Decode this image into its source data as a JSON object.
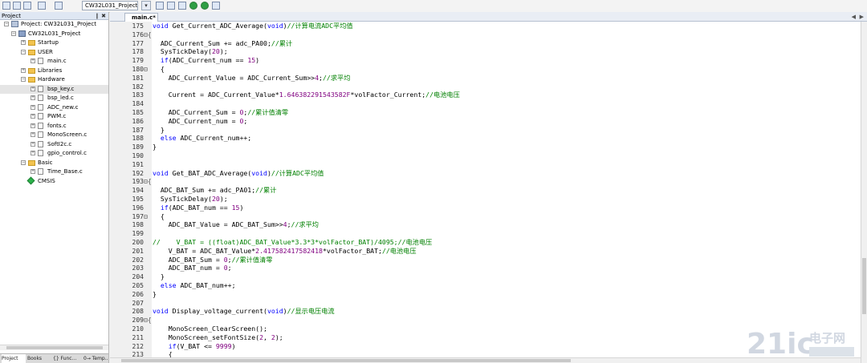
{
  "toolbar": {
    "target_name": "CW32L031_Project"
  },
  "project_panel": {
    "title": "Project",
    "controls": "❙ ✖",
    "tree": [
      {
        "label": "Project: CW32L031_Project",
        "level": 0,
        "icon": "project-icon",
        "expander": "−"
      },
      {
        "label": "CW32L031_Project",
        "level": 1,
        "icon": "target-icon",
        "expander": "−"
      },
      {
        "label": "Startup",
        "level": 2,
        "icon": "folder-icon",
        "expander": "+"
      },
      {
        "label": "USER",
        "level": 2,
        "icon": "folder-icon",
        "expander": "−"
      },
      {
        "label": "main.c",
        "level": 3,
        "icon": "file-icon",
        "expander": "+"
      },
      {
        "label": "Libraries",
        "level": 2,
        "icon": "folder-icon",
        "expander": "+"
      },
      {
        "label": "Hardware",
        "level": 2,
        "icon": "folder-icon",
        "expander": "−"
      },
      {
        "label": "bsp_key.c",
        "level": 3,
        "icon": "file-icon",
        "expander": "+",
        "selected": true
      },
      {
        "label": "bsp_led.c",
        "level": 3,
        "icon": "file-icon",
        "expander": "+"
      },
      {
        "label": "ADC_new.c",
        "level": 3,
        "icon": "file-icon",
        "expander": "+"
      },
      {
        "label": "PWM.c",
        "level": 3,
        "icon": "file-icon",
        "expander": "+"
      },
      {
        "label": "fonts.c",
        "level": 3,
        "icon": "file-icon",
        "expander": "+"
      },
      {
        "label": "MonoScreen.c",
        "level": 3,
        "icon": "file-icon",
        "expander": "+"
      },
      {
        "label": "SoftI2c.c",
        "level": 3,
        "icon": "file-icon",
        "expander": "+"
      },
      {
        "label": "gpio_control.c",
        "level": 3,
        "icon": "file-icon",
        "expander": "+"
      },
      {
        "label": "Basic",
        "level": 2,
        "icon": "folder-icon",
        "expander": "−"
      },
      {
        "label": "Time_Base.c",
        "level": 3,
        "icon": "file-icon",
        "expander": "+"
      },
      {
        "label": "CMSIS",
        "level": 2,
        "icon": "gem-icon",
        "expander": ""
      }
    ],
    "bottom_tabs": [
      {
        "label": "Project",
        "active": true
      },
      {
        "label": "Books"
      },
      {
        "label": "{} Func..."
      },
      {
        "label": "0→ Temp..."
      }
    ]
  },
  "editor": {
    "tab_label": "main.c*",
    "lines": [
      {
        "n": "175",
        "fold": "",
        "segs": [
          [
            "kw",
            "void"
          ],
          [
            "t",
            " Get_Current_ADC_Average("
          ],
          [
            "kw",
            "void"
          ],
          [
            "t",
            ")"
          ],
          [
            "cm",
            "//计算电流ADC平均值"
          ]
        ]
      },
      {
        "n": "176",
        "fold": "⊟{",
        "segs": []
      },
      {
        "n": "177",
        "fold": "",
        "segs": [
          [
            "t",
            "  ADC_Current_Sum += adc_PA00;"
          ],
          [
            "cm",
            "//累计"
          ]
        ]
      },
      {
        "n": "178",
        "fold": "",
        "segs": [
          [
            "t",
            "  SysTickDelay("
          ],
          [
            "num",
            "20"
          ],
          [
            "t",
            ");"
          ]
        ]
      },
      {
        "n": "179",
        "fold": "",
        "segs": [
          [
            "t",
            "  "
          ],
          [
            "kw",
            "if"
          ],
          [
            "t",
            "(ADC_Current_num == "
          ],
          [
            "num",
            "15"
          ],
          [
            "t",
            ")"
          ]
        ]
      },
      {
        "n": "180",
        "fold": "⊟",
        "segs": [
          [
            "t",
            "  {"
          ]
        ]
      },
      {
        "n": "181",
        "fold": "",
        "segs": [
          [
            "t",
            "    ADC_Current_Value = ADC_Current_Sum>>"
          ],
          [
            "num",
            "4"
          ],
          [
            "t",
            ";"
          ],
          [
            "cm",
            "//求平均"
          ]
        ]
      },
      {
        "n": "182",
        "fold": "",
        "segs": []
      },
      {
        "n": "183",
        "fold": "",
        "segs": [
          [
            "t",
            "    Current = ADC_Current_Value*"
          ],
          [
            "num",
            "1.646382291543582F"
          ],
          [
            "t",
            "*volFactor_Current;"
          ],
          [
            "cm",
            "//电池电压"
          ]
        ]
      },
      {
        "n": "184",
        "fold": "",
        "segs": []
      },
      {
        "n": "185",
        "fold": "",
        "segs": [
          [
            "t",
            "    ADC_Current_Sum = "
          ],
          [
            "num",
            "0"
          ],
          [
            "t",
            ";"
          ],
          [
            "cm",
            "//累计值清零"
          ]
        ]
      },
      {
        "n": "186",
        "fold": "",
        "segs": [
          [
            "t",
            "    ADC_Current_num = "
          ],
          [
            "num",
            "0"
          ],
          [
            "t",
            ";"
          ]
        ]
      },
      {
        "n": "187",
        "fold": "",
        "segs": [
          [
            "t",
            "  }"
          ]
        ]
      },
      {
        "n": "188",
        "fold": "",
        "segs": [
          [
            "t",
            "  "
          ],
          [
            "kw",
            "else"
          ],
          [
            "t",
            " ADC_Current_num++;"
          ]
        ]
      },
      {
        "n": "189",
        "fold": "",
        "segs": [
          [
            "t",
            "}"
          ]
        ]
      },
      {
        "n": "190",
        "fold": "",
        "segs": []
      },
      {
        "n": "191",
        "fold": "",
        "segs": []
      },
      {
        "n": "192",
        "fold": "",
        "segs": [
          [
            "kw",
            "void"
          ],
          [
            "t",
            " Get_BAT_ADC_Average("
          ],
          [
            "kw",
            "void"
          ],
          [
            "t",
            ")"
          ],
          [
            "cm",
            "//计算ADC平均值"
          ]
        ]
      },
      {
        "n": "193",
        "fold": "⊟{",
        "segs": []
      },
      {
        "n": "194",
        "fold": "",
        "segs": [
          [
            "t",
            "  ADC_BAT_Sum += adc_PA01;"
          ],
          [
            "cm",
            "//累计"
          ]
        ]
      },
      {
        "n": "195",
        "fold": "",
        "segs": [
          [
            "t",
            "  SysTickDelay("
          ],
          [
            "num",
            "20"
          ],
          [
            "t",
            ");"
          ]
        ]
      },
      {
        "n": "196",
        "fold": "",
        "segs": [
          [
            "t",
            "  "
          ],
          [
            "kw",
            "if"
          ],
          [
            "t",
            "(ADC_BAT_num == "
          ],
          [
            "num",
            "15"
          ],
          [
            "t",
            ")"
          ]
        ]
      },
      {
        "n": "197",
        "fold": "⊟",
        "segs": [
          [
            "t",
            "  {"
          ]
        ]
      },
      {
        "n": "198",
        "fold": "",
        "segs": [
          [
            "t",
            "    ADC_BAT_Value = ADC_BAT_Sum>>"
          ],
          [
            "num",
            "4"
          ],
          [
            "t",
            ";"
          ],
          [
            "cm",
            "//求平均"
          ]
        ]
      },
      {
        "n": "199",
        "fold": "",
        "segs": []
      },
      {
        "n": "200",
        "fold": "",
        "segs": [
          [
            "cm",
            "//    V_BAT = ((float)ADC_BAT_Value*3.3*3*volFactor_BAT)/4095;//电池电压"
          ]
        ]
      },
      {
        "n": "201",
        "fold": "",
        "segs": [
          [
            "t",
            "    V_BAT = ADC_BAT_Value*"
          ],
          [
            "num",
            "2.417582417582418"
          ],
          [
            "t",
            "*volFactor_BAT;"
          ],
          [
            "cm",
            "//电池电压"
          ]
        ]
      },
      {
        "n": "202",
        "fold": "",
        "segs": [
          [
            "t",
            "    ADC_BAT_Sum = "
          ],
          [
            "num",
            "0"
          ],
          [
            "t",
            ";"
          ],
          [
            "cm",
            "//累计值清零"
          ]
        ]
      },
      {
        "n": "203",
        "fold": "",
        "segs": [
          [
            "t",
            "    ADC_BAT_num = "
          ],
          [
            "num",
            "0"
          ],
          [
            "t",
            ";"
          ]
        ]
      },
      {
        "n": "204",
        "fold": "",
        "segs": [
          [
            "t",
            "  }"
          ]
        ]
      },
      {
        "n": "205",
        "fold": "",
        "segs": [
          [
            "t",
            "  "
          ],
          [
            "kw",
            "else"
          ],
          [
            "t",
            " ADC_BAT_num++;"
          ]
        ]
      },
      {
        "n": "206",
        "fold": "",
        "segs": [
          [
            "t",
            "}"
          ]
        ]
      },
      {
        "n": "207",
        "fold": "",
        "segs": []
      },
      {
        "n": "208",
        "fold": "",
        "segs": [
          [
            "kw",
            "void"
          ],
          [
            "t",
            " Display_voltage_current("
          ],
          [
            "kw",
            "void"
          ],
          [
            "t",
            ")"
          ],
          [
            "cm",
            "//显示电压电流"
          ]
        ]
      },
      {
        "n": "209",
        "fold": "⊟{",
        "segs": []
      },
      {
        "n": "210",
        "fold": "",
        "segs": [
          [
            "t",
            "    MonoScreen_ClearScreen();"
          ]
        ]
      },
      {
        "n": "211",
        "fold": "",
        "segs": [
          [
            "t",
            "    MonoScreen_setFontSize("
          ],
          [
            "num",
            "2"
          ],
          [
            "t",
            ", "
          ],
          [
            "num",
            "2"
          ],
          [
            "t",
            ");"
          ]
        ]
      },
      {
        "n": "212",
        "fold": "",
        "segs": [
          [
            "t",
            "    "
          ],
          [
            "kw",
            "if"
          ],
          [
            "t",
            "(V_BAT <= "
          ],
          [
            "num",
            "9999"
          ],
          [
            "t",
            ")"
          ]
        ]
      },
      {
        "n": "213",
        "fold": "",
        "segs": [
          [
            "t",
            "    {"
          ]
        ]
      }
    ]
  },
  "watermark": {
    "logo_text": "21ic",
    "cn_text": "电子网"
  }
}
